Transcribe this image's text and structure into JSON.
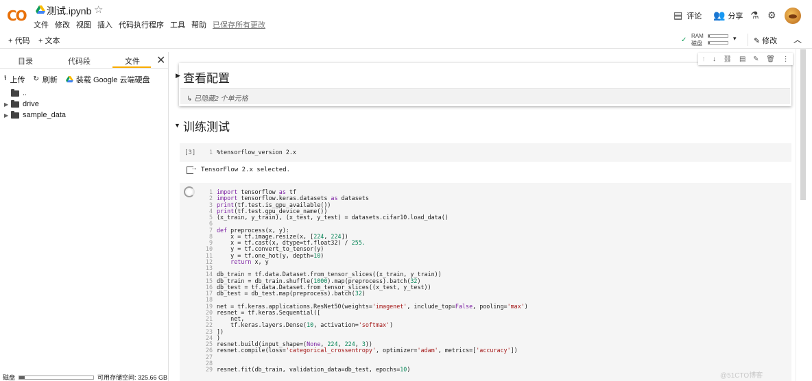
{
  "app": {
    "logo": "CO",
    "notebook_title": "测试.ipynb"
  },
  "menu": [
    "文件",
    "修改",
    "视图",
    "插入",
    "代码执行程序",
    "工具",
    "帮助"
  ],
  "menu_saved": "已保存所有更改",
  "header_actions": {
    "comment": "评论",
    "share": "分享"
  },
  "toolbar": {
    "add_code": "+ 代码",
    "add_text": "+ 文本",
    "ram_label": "RAM",
    "disk_label": "磁盘",
    "edit": "修改"
  },
  "sidebar": {
    "tabs": [
      "目录",
      "代码段",
      "文件"
    ],
    "active_tab": "文件",
    "actions": {
      "upload": "上传",
      "refresh": "刷新",
      "mount": "装载 Google 云端硬盘"
    },
    "tree": [
      {
        "name": "..",
        "type": "parent"
      },
      {
        "name": "drive",
        "type": "folder"
      },
      {
        "name": "sample_data",
        "type": "folder"
      }
    ],
    "footer": {
      "disk_label": "磁盘",
      "available": "可用存储空间: 325.66 GB"
    }
  },
  "notebook": {
    "section1_title": "查看配置",
    "hidden_cells": "↳ 已隐藏2 个单元格",
    "section2_title": "训练测试",
    "cell1": {
      "exec_count": "[3]",
      "code": "%tensorflow_version 2.x",
      "output": "TensorFlow 2.x selected."
    },
    "cell2_lines": [
      "import tensorflow as tf",
      "import tensorflow.keras.datasets as datasets",
      "print(tf.test.is_gpu_available())",
      "print(tf.test.gpu_device_name())",
      "(x_train, y_train), (x_test, y_test) = datasets.cifar10.load_data()",
      "",
      "def preprocess(x, y):",
      "    x = tf.image.resize(x, [224, 224])",
      "    x = tf.cast(x, dtype=tf.float32) / 255.",
      "    y = tf.convert_to_tensor(y)",
      "    y = tf.one_hot(y, depth=10)",
      "    return x, y",
      "",
      "db_train = tf.data.Dataset.from_tensor_slices((x_train, y_train))",
      "db_train = db_train.shuffle(1000).map(preprocess).batch(32)",
      "db_test = tf.data.Dataset.from_tensor_slices((x_test, y_test))",
      "db_test = db_test.map(preprocess).batch(32)",
      "",
      "net = tf.keras.applications.ResNet50(weights='imagenet', include_top=False, pooling='max')",
      "resnet = tf.keras.Sequential([",
      "    net,",
      "    tf.keras.layers.Dense(10, activation='softmax')",
      "])",
      ")",
      "resnet.build(input_shape=(None, 224, 224, 3))",
      "resnet.compile(loss='categorical_crossentropy', optimizer='adam', metrics=['accuracy'])",
      "",
      "",
      "resnet.fit(db_train, validation_data=db_test, epochs=10)"
    ]
  },
  "watermark": "@51CTO博客"
}
